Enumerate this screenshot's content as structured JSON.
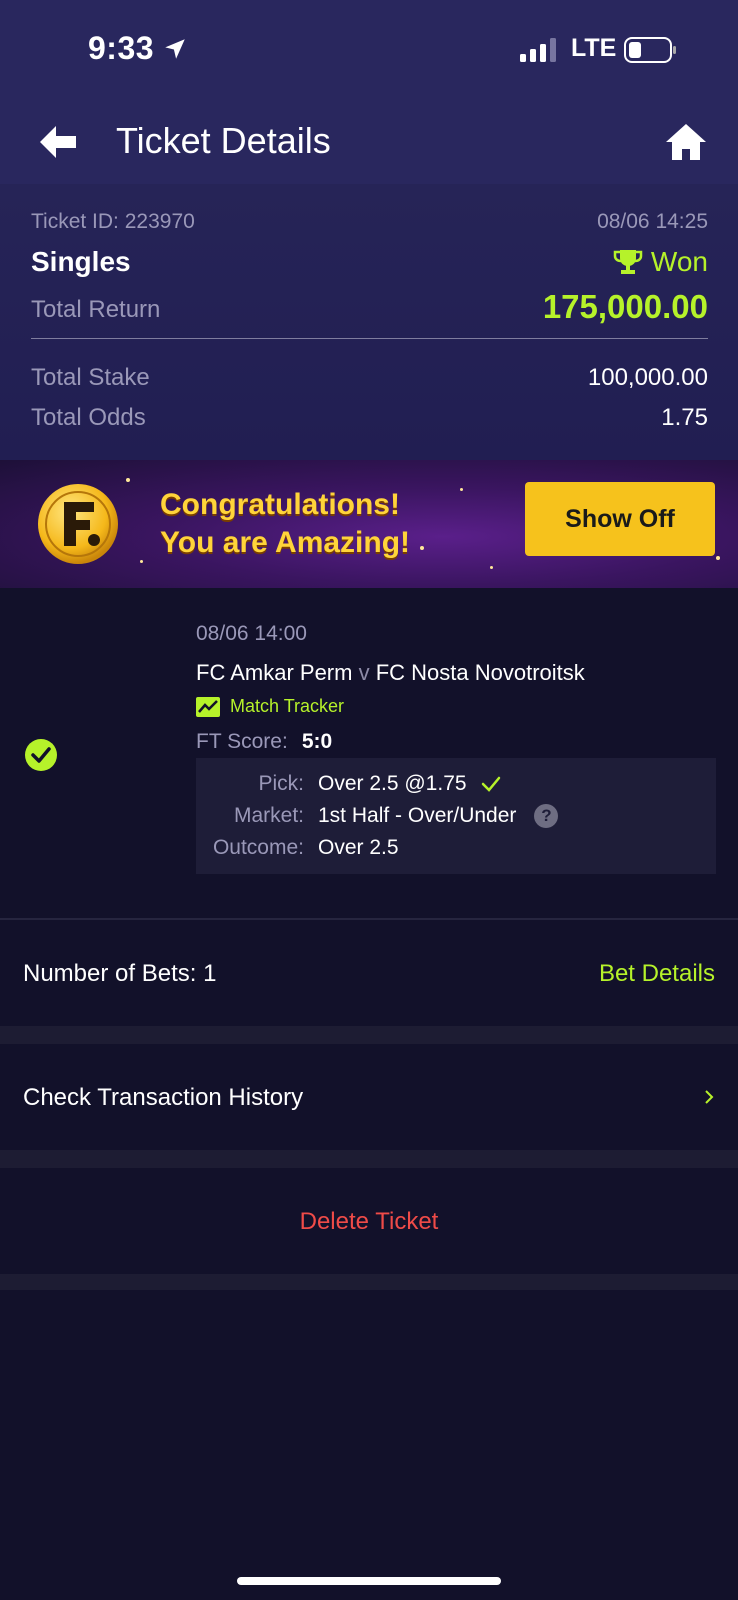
{
  "status_bar": {
    "time": "9:33",
    "network": "LTE"
  },
  "nav": {
    "title": "Ticket Details"
  },
  "summary": {
    "ticket_id": "Ticket ID: 223970",
    "datetime": "08/06 14:25",
    "bet_type": "Singles",
    "status": "Won",
    "total_return_label": "Total Return",
    "total_return_value": "175,000.00",
    "total_stake_label": "Total Stake",
    "total_stake_value": "100,000.00",
    "total_odds_label": "Total Odds",
    "total_odds_value": "1.75"
  },
  "banner": {
    "line1": "Congratulations!",
    "line2": "You are Amazing!",
    "button": "Show Off"
  },
  "bet": {
    "event_time": "08/06 14:00",
    "home_team": "FC Amkar Perm",
    "vs": "v",
    "away_team": "FC Nosta Novotroitsk",
    "tracker_label": "Match Tracker",
    "ft_score_label": "FT Score:",
    "ft_score_value": "5:0",
    "pick_label": "Pick:",
    "pick_value": "Over 2.5 @1.75",
    "market_label": "Market:",
    "market_value": "1st Half - Over/Under",
    "outcome_label": "Outcome:",
    "outcome_value": "Over 2.5"
  },
  "footer": {
    "bets_count": "Number of Bets: 1",
    "bet_details": "Bet Details",
    "history": "Check Transaction History",
    "history_chevron": "›",
    "delete": "Delete Ticket",
    "help": "?"
  },
  "colors": {
    "accent": "#b6f22a",
    "header": "#29275e",
    "background": "#12112a",
    "danger": "#ef4b48",
    "button": "#f6c21c"
  },
  "icons": [
    "location-arrow-icon",
    "signal-icon",
    "battery-icon",
    "back-arrow-icon",
    "home-icon",
    "trophy-icon",
    "check-circle-icon",
    "match-tracker-icon",
    "checkmark-icon",
    "help-icon",
    "chevron-right-icon"
  ]
}
